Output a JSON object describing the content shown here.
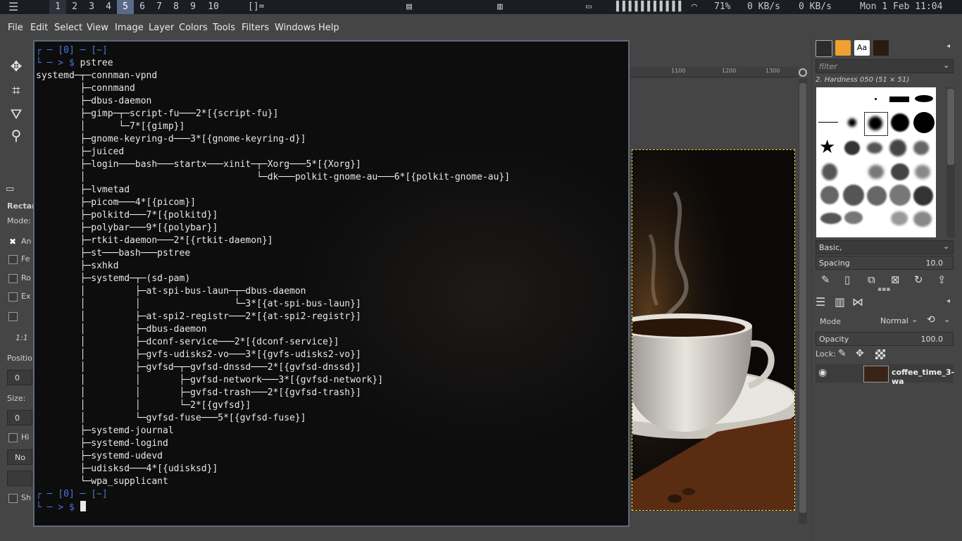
{
  "topbar": {
    "workspaces": [
      "1",
      "2",
      "3",
      "4",
      "5",
      "6",
      "7",
      "8",
      "9",
      "10"
    ],
    "active_workspace": "5",
    "layout_indicator": "[]=",
    "wifi_percent": "71%",
    "net_down": "0 KB/s",
    "net_up": "0 KB/s",
    "date": "Mon  1 Feb 11:04"
  },
  "menubar": {
    "items": [
      "File",
      "Edit",
      "Select",
      "View",
      "Image",
      "Layer",
      "Colors",
      "Tools",
      "Filters",
      "Windows",
      "Help"
    ]
  },
  "toolbox": {
    "tool_title": "Rectan",
    "mode_label": "Mode:",
    "antialias_label": "An",
    "feather_label": "Fe",
    "round_label": "Ro",
    "expand_label": "Ex",
    "ratio_value": "1:1",
    "position_label": "Positio",
    "position_value": "0",
    "size_label": "Size:",
    "size_value": "0",
    "highlight_label": "Hi",
    "guides_value": "No gu",
    "shrink_label": "Sh"
  },
  "ruler": {
    "ticks": [
      "1100",
      "1200",
      "1300"
    ]
  },
  "brushes": {
    "filter_placeholder": "filter",
    "selected_brush": "2. Hardness 050 (51 × 51)",
    "tag_select": "Basic,",
    "spacing_label": "Spacing",
    "spacing_value": "10.0"
  },
  "layers": {
    "mode_label": "Mode",
    "mode_value": "Normal",
    "opacity_label": "Opacity",
    "opacity_value": "100.0",
    "lock_label": "Lock:",
    "layer_name": "coffee_time_3-wa"
  },
  "terminal": {
    "prompt_top": "┌ ─ [0] ─ [~]",
    "prompt_bottom": "└ ─ > $",
    "command": "pstree",
    "output": [
      "systemd─┬─connman-vpnd",
      "        ├─connmand",
      "        ├─dbus-daemon",
      "        ├─gimp─┬─script-fu───2*[{script-fu}]",
      "        │      └─7*[{gimp}]",
      "        ├─gnome-keyring-d───3*[{gnome-keyring-d}]",
      "        ├─juiced",
      "        ├─login───bash───startx───xinit─┬─Xorg───5*[{Xorg}]",
      "        │                               └─dk───polkit-gnome-au───6*[{polkit-gnome-au}]",
      "        ├─lvmetad",
      "        ├─picom───4*[{picom}]",
      "        ├─polkitd───7*[{polkitd}]",
      "        ├─polybar───9*[{polybar}]",
      "        ├─rtkit-daemon───2*[{rtkit-daemon}]",
      "        ├─st───bash───pstree",
      "        ├─sxhkd",
      "        ├─systemd─┬─(sd-pam)",
      "        │         ├─at-spi-bus-laun─┬─dbus-daemon",
      "        │         │                 └─3*[{at-spi-bus-laun}]",
      "        │         ├─at-spi2-registr───2*[{at-spi2-registr}]",
      "        │         ├─dbus-daemon",
      "        │         ├─dconf-service───2*[{dconf-service}]",
      "        │         ├─gvfs-udisks2-vo───3*[{gvfs-udisks2-vo}]",
      "        │         ├─gvfsd─┬─gvfsd-dnssd───2*[{gvfsd-dnssd}]",
      "        │         │       ├─gvfsd-network───3*[{gvfsd-network}]",
      "        │         │       ├─gvfsd-trash───2*[{gvfsd-trash}]",
      "        │         │       └─2*[{gvfsd}]",
      "        │         └─gvfsd-fuse───5*[{gvfsd-fuse}]",
      "        ├─systemd-journal",
      "        ├─systemd-logind",
      "        ├─systemd-udevd",
      "        ├─udisksd───4*[{udisksd}]",
      "        └─wpa_supplicant"
    ]
  }
}
